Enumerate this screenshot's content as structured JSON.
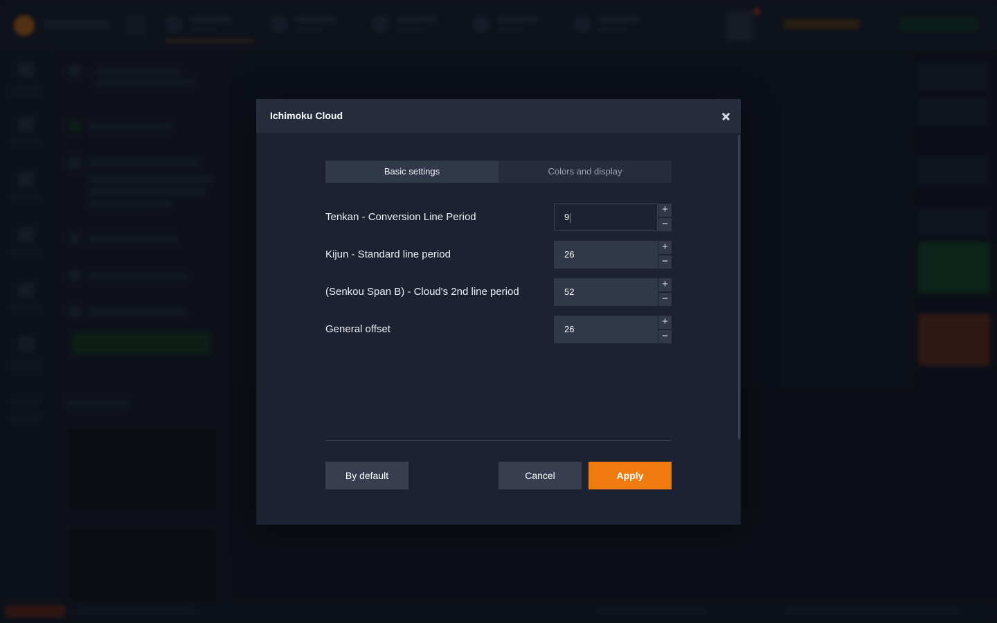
{
  "modal": {
    "title": "Ichimoku Cloud",
    "close_icon": "close-icon",
    "tabs": [
      {
        "label": "Basic settings",
        "active": true
      },
      {
        "label": "Colors and display",
        "active": false
      }
    ],
    "fields": [
      {
        "label": "Tenkan - Conversion Line Period",
        "value": "9",
        "focused": true
      },
      {
        "label": "Kijun - Standard line period",
        "value": "26"
      },
      {
        "label": "(Senkou Span B) - Cloud's 2nd line period",
        "value": "52"
      },
      {
        "label": "General offset",
        "value": "26"
      }
    ],
    "stepper": {
      "plus": "+",
      "minus": "−"
    },
    "buttons": {
      "default_label": "By default",
      "cancel_label": "Cancel",
      "apply_label": "Apply"
    }
  },
  "colors": {
    "accent": "#ef7a0d",
    "modal_bg": "#1d2232",
    "header_bg": "#262c3c",
    "input_bg": "#313849",
    "button_bg": "#383e4f"
  }
}
